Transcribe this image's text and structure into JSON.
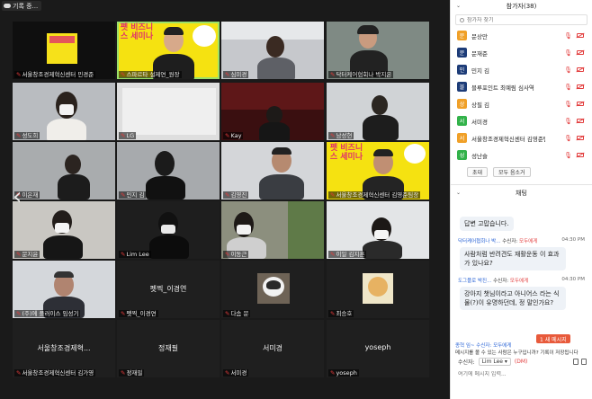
{
  "recording": {
    "label": "기록 중..."
  },
  "tiles": [
    {
      "name": "서울창조경제혁신센터 민경준",
      "center": ""
    },
    {
      "name": "스파르타 설제연_원장",
      "center": ""
    },
    {
      "name": "심미경",
      "center": ""
    },
    {
      "name": "닥터케어협회나 박지은",
      "center": ""
    },
    {
      "name": "성도희",
      "center": ""
    },
    {
      "name": "LG",
      "center": ""
    },
    {
      "name": "Kay",
      "center": ""
    },
    {
      "name": "남성현",
      "center": ""
    },
    {
      "name": "이은재",
      "center": ""
    },
    {
      "name": "민지 김",
      "center": ""
    },
    {
      "name": "김영진",
      "center": ""
    },
    {
      "name": "서울창조경제혁신센터 김영준팀장",
      "center": ""
    },
    {
      "name": "문지윤",
      "center": ""
    },
    {
      "name": "Lim Lee",
      "center": ""
    },
    {
      "name": "이동근",
      "center": ""
    },
    {
      "name": "이일 김지훈",
      "center": ""
    },
    {
      "name": "(주)에 플러이스 임성기",
      "center": ""
    },
    {
      "name": "펫찍_이경연",
      "center": "펫찍_이경연"
    },
    {
      "name": "다솜 문",
      "center": ""
    },
    {
      "name": "최승호",
      "center": ""
    },
    {
      "name": "서울창조경제혁신센터 김가영",
      "center": "서울창조경제혁..."
    },
    {
      "name": "정재필",
      "center": "정재필"
    },
    {
      "name": "서미경",
      "center": "서미경"
    },
    {
      "name": "yoseph",
      "center": "yoseph"
    }
  ],
  "banner_text": "펫 비즈니스 세미나",
  "participants_panel": {
    "title": "참가자(38)",
    "search_placeholder": "참가자 찾기",
    "participants": [
      {
        "initial": "문",
        "name": "문상만",
        "color": "#f0a028"
      },
      {
        "initial": "문",
        "name": "문재준",
        "color": "#1d3c78"
      },
      {
        "initial": "민",
        "name": "민지 김",
        "color": "#1d3c78"
      },
      {
        "initial": "블",
        "name": "블루포인트 최예림 심사역",
        "color": "#1d3c78"
      },
      {
        "initial": "상",
        "name": "상필 김",
        "color": "#f0a028"
      },
      {
        "initial": "서",
        "name": "서미경",
        "color": "#32b24a"
      },
      {
        "initial": "서",
        "name": "서울창조경제혁신센터 김영준팀장",
        "color": "#f0a028"
      },
      {
        "initial": "성",
        "name": "성난슬",
        "color": "#32b24a"
      }
    ],
    "buttons": [
      "초대",
      "모두 음소거"
    ]
  },
  "chat_panel": {
    "title": "채팅",
    "messages": [
      {
        "type": "self",
        "text": "답변 고맙습니다."
      },
      {
        "from": "닥터케어협회나 박...",
        "to_label": "수신자:",
        "to": "모두에게",
        "time": "04:30 PM",
        "text": "사람처럼 반려견도 재활운동 이 효과가 있나요?"
      },
      {
        "from": "도그플로 박진...",
        "to_label": "수신자:",
        "to": "모두에게",
        "time": "04:30 PM",
        "text": "강아지 챗님이라고 아니어스 라는 식물(?)이 유명하던데, 정 말인가요?"
      }
    ],
    "new_message_badge": "1 새 메시지",
    "notice": "종혁 임~ 수신자: 모두에게",
    "notice2": "메시지를 볼 수 있는 사람은 누구입니까? 기록이 저장됩니다",
    "recipient_label": "수신자:",
    "recipient_value": "Lim Lee",
    "recipient_dm": "(DM)",
    "input_placeholder": "여기에 메시지 입력..."
  }
}
